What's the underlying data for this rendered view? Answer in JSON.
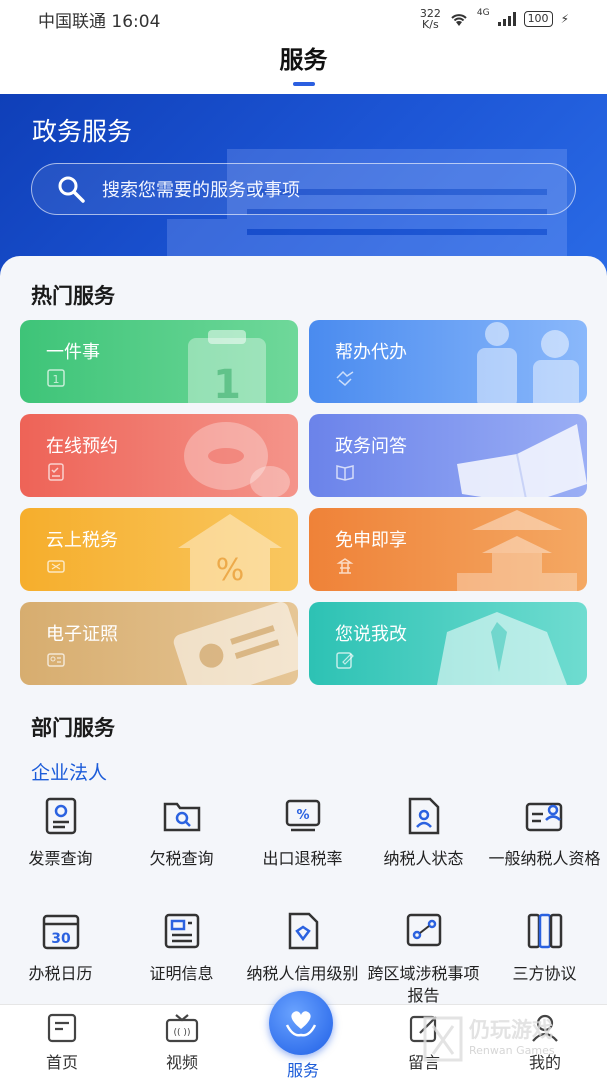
{
  "status": {
    "carrier_time": "中国联通 16:04",
    "speed_value": "322",
    "speed_unit": "K/s",
    "network": "4G",
    "battery": "100"
  },
  "header": {
    "title": "服务"
  },
  "banner": {
    "title": "政务服务",
    "search_placeholder": "搜索您需要的服务或事项"
  },
  "hot": {
    "title": "热门服务",
    "cards": [
      {
        "label": "一件事",
        "color": "#3fc57a"
      },
      {
        "label": "帮办代办",
        "color": "#4f8ff0"
      },
      {
        "label": "在线预约",
        "color": "#ee6a5e"
      },
      {
        "label": "政务问答",
        "color": "#6b86ea"
      },
      {
        "label": "云上税务",
        "color": "#f5b032"
      },
      {
        "label": "免申即享",
        "color": "#f08a3e"
      },
      {
        "label": "电子证照",
        "color": "#d6ae72"
      },
      {
        "label": "您说我改",
        "color": "#2fc4b8"
      }
    ]
  },
  "dept": {
    "title": "部门服务",
    "subtitle": "企业法人",
    "row1": [
      "发票查询",
      "欠税查询",
      "出口退税率",
      "纳税人状态",
      "一般纳税人资格"
    ],
    "row2": [
      "办税日历",
      "证明信息",
      "纳税人信用级别",
      "跨区域涉税事项报告",
      "三方协议"
    ]
  },
  "tabs": [
    "首页",
    "视频",
    "服务",
    "留言",
    "我的"
  ],
  "watermark": {
    "title": "仍玩游戏",
    "sub": "Renwan Games"
  },
  "colors": {
    "accent": "#1c5cd9",
    "banner": "#1a4fcf"
  }
}
